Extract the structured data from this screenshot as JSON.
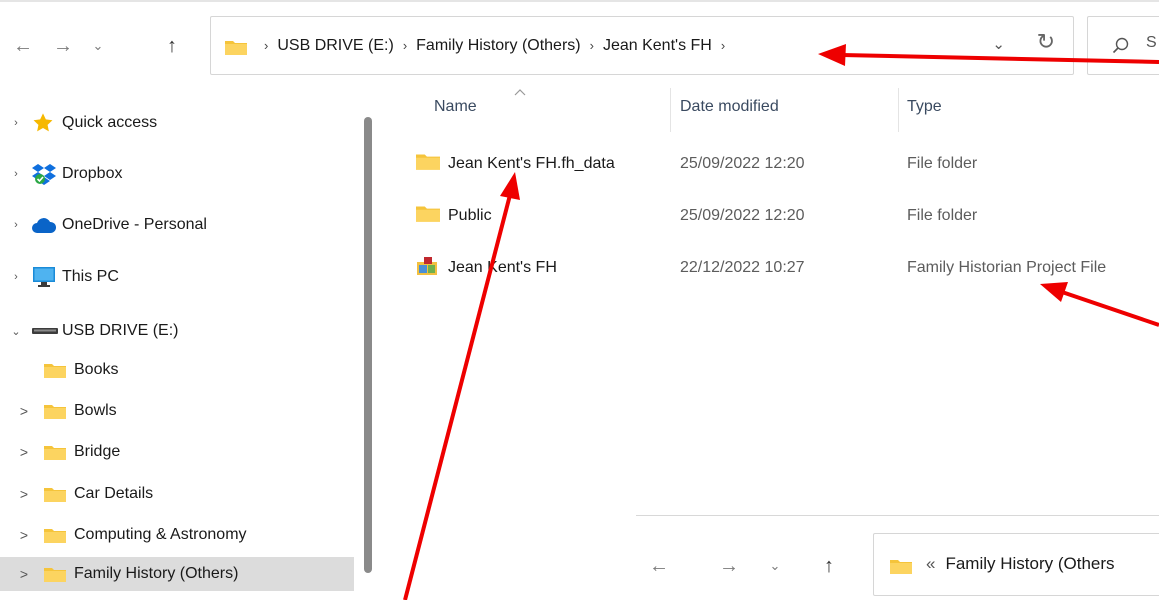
{
  "nav": {
    "back_icon": "←",
    "forward_icon": "→",
    "recent_icon": "⌄",
    "up_icon": "↑"
  },
  "address_bar": {
    "breadcrumbs": [
      "USB DRIVE (E:)",
      "Family History (Others)",
      "Jean Kent's FH"
    ],
    "separator": "›",
    "dropdown_icon": "⌄",
    "refresh_icon": "↻"
  },
  "search": {
    "label": "S"
  },
  "sidebar": {
    "items": [
      {
        "label": "Quick access",
        "icon": "star-icon",
        "chevron": "›"
      },
      {
        "label": "Dropbox",
        "icon": "dropbox-icon",
        "chevron": "›"
      },
      {
        "label": "OneDrive - Personal",
        "icon": "cloud-icon",
        "chevron": "›"
      },
      {
        "label": "This PC",
        "icon": "monitor-icon",
        "chevron": "›"
      },
      {
        "label": "USB DRIVE (E:)",
        "icon": "drive-icon",
        "chevron": "⌄"
      },
      {
        "label": "Books",
        "icon": "folder-icon",
        "chevron": ""
      },
      {
        "label": "Bowls",
        "icon": "folder-icon",
        "chevron": ">"
      },
      {
        "label": "Bridge",
        "icon": "folder-icon",
        "chevron": ">"
      },
      {
        "label": "Car Details",
        "icon": "folder-icon",
        "chevron": ">"
      },
      {
        "label": "Computing & Astronomy",
        "icon": "folder-icon",
        "chevron": ">"
      },
      {
        "label": "Family History (Others)",
        "icon": "folder-icon",
        "chevron": ">"
      }
    ]
  },
  "columns": {
    "name": "Name",
    "date": "Date modified",
    "type": "Type"
  },
  "files": [
    {
      "name": "Jean Kent's FH.fh_data",
      "date": "25/09/2022 12:20",
      "type": "File folder",
      "icon": "folder-icon"
    },
    {
      "name": "Public",
      "date": "25/09/2022 12:20",
      "type": "File folder",
      "icon": "folder-icon"
    },
    {
      "name": "Jean Kent's FH",
      "date": "22/12/2022 10:27",
      "type": "Family Historian  Project File",
      "icon": "fh-project-icon"
    }
  ],
  "lower_window": {
    "back_icon": "←",
    "forward_icon": "→",
    "recent_icon": "⌄",
    "up_icon": "↑",
    "chevrons": "«",
    "path": "Family History (Others"
  },
  "colors": {
    "annotation_arrow": "#ee0000",
    "folder": "#f5c43b",
    "selection": "#dcdcdc"
  }
}
